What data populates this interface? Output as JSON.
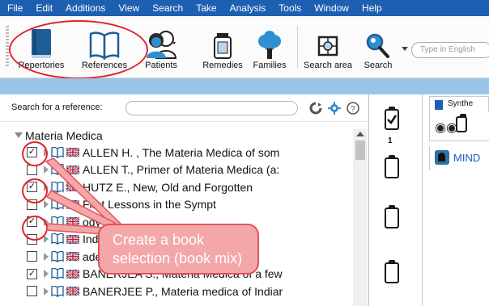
{
  "menu": [
    "File",
    "Edit",
    "Additions",
    "View",
    "Search",
    "Take",
    "Analysis",
    "Tools",
    "Window",
    "Help"
  ],
  "toolbar": {
    "repertories": "Repertories",
    "references": "References",
    "patients": "Patients",
    "remedies": "Remedies",
    "families": "Families",
    "search_area": "Search area",
    "search": "Search",
    "search_placeholder": "Type in English"
  },
  "reference_panel": {
    "search_label": "Search for a reference:",
    "root": "Materia Medica",
    "rows": [
      {
        "checked": true,
        "text": "ALLEN H. , The Materia Medica of som"
      },
      {
        "checked": false,
        "text": "ALLEN T., Primer of Materia Medica (a:"
      },
      {
        "checked": true,
        "text": "HUTZ E., New, Old and Forgotten"
      },
      {
        "checked": false,
        "text": "First Lessons in the Sympt"
      },
      {
        "checked": true,
        "text": "ogy (l"
      },
      {
        "checked": false,
        "text": "India"
      },
      {
        "checked": false,
        "text": "ade e"
      },
      {
        "checked": true,
        "text": "BANERJEA S., Materia Medica of a few"
      },
      {
        "checked": false,
        "text": "BANERJEE P., Materia medica of Indiar"
      }
    ]
  },
  "clipboard_column": {
    "active_number": "1"
  },
  "right_panel": {
    "tab_title": "Synthe",
    "item": "MIND"
  },
  "callout": {
    "text": "Create a book selection (book mix)"
  },
  "colors": {
    "menubar": "#1d5fb0",
    "annotation_red": "#e0242a",
    "callout_fill": "#f3a7a9"
  }
}
